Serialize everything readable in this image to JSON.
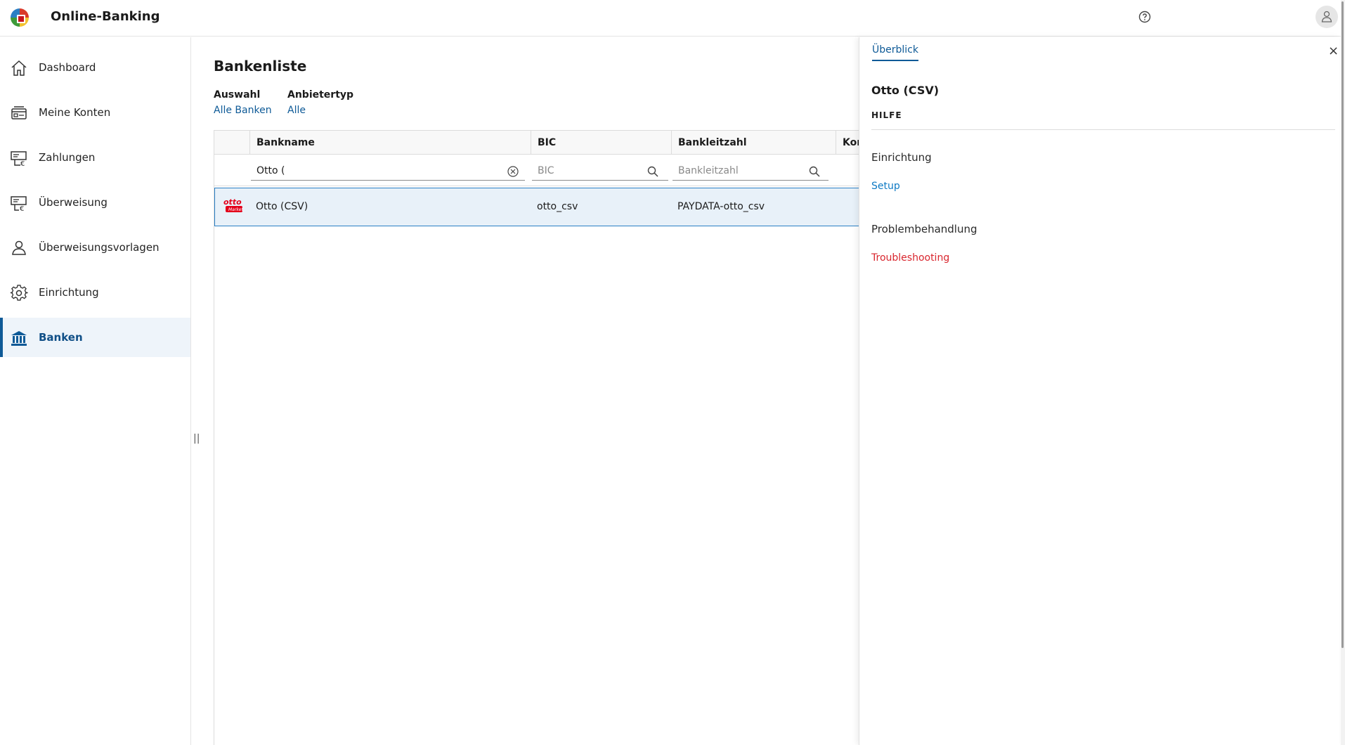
{
  "header": {
    "app_title": "Online-Banking",
    "help_icon": "help-circle-icon",
    "user_icon": "user-icon"
  },
  "sidebar": {
    "items": [
      {
        "label": "Dashboard",
        "icon": "home-icon"
      },
      {
        "label": "Meine Konten",
        "icon": "accounts-icon"
      },
      {
        "label": "Zahlungen",
        "icon": "payments-icon"
      },
      {
        "label": "Überweisung",
        "icon": "transfer-icon"
      },
      {
        "label": "Überweisungsvorlagen",
        "icon": "person-template-icon"
      },
      {
        "label": "Einrichtung",
        "icon": "gear-icon"
      },
      {
        "label": "Banken",
        "icon": "bank-icon",
        "active": true
      }
    ],
    "collapse_glyph": "||"
  },
  "main": {
    "title": "Bankenliste",
    "filters": [
      {
        "label": "Auswahl",
        "value": "Alle Banken"
      },
      {
        "label": "Anbietertyp",
        "value": "Alle"
      }
    ],
    "table": {
      "columns": [
        "Bankname",
        "BIC",
        "Bankleitzahl",
        "Kont"
      ],
      "filter_values": {
        "bankname": "Otto (",
        "bic_placeholder": "BIC",
        "blz_placeholder": "Bankleitzahl"
      },
      "rows": [
        {
          "logo_text": "otto",
          "logo_subtext": "Market",
          "bankname": "Otto (CSV)",
          "bic": "otto_csv",
          "blz": "PAYDATA-otto_csv"
        }
      ]
    }
  },
  "panel": {
    "tab": "Überblick",
    "close_glyph": "×",
    "title": "Otto (CSV)",
    "section": "HILFE",
    "entries": [
      {
        "heading": "Einrichtung",
        "link": "Setup",
        "link_color": "#0e7ac4"
      },
      {
        "heading": "Problembehandlung",
        "link": "Troubleshooting",
        "link_color": "#d9262e"
      }
    ]
  },
  "colors": {
    "accent": "#0e5a97",
    "selected_row": "#e8f1f9",
    "error_link": "#d9262e"
  }
}
